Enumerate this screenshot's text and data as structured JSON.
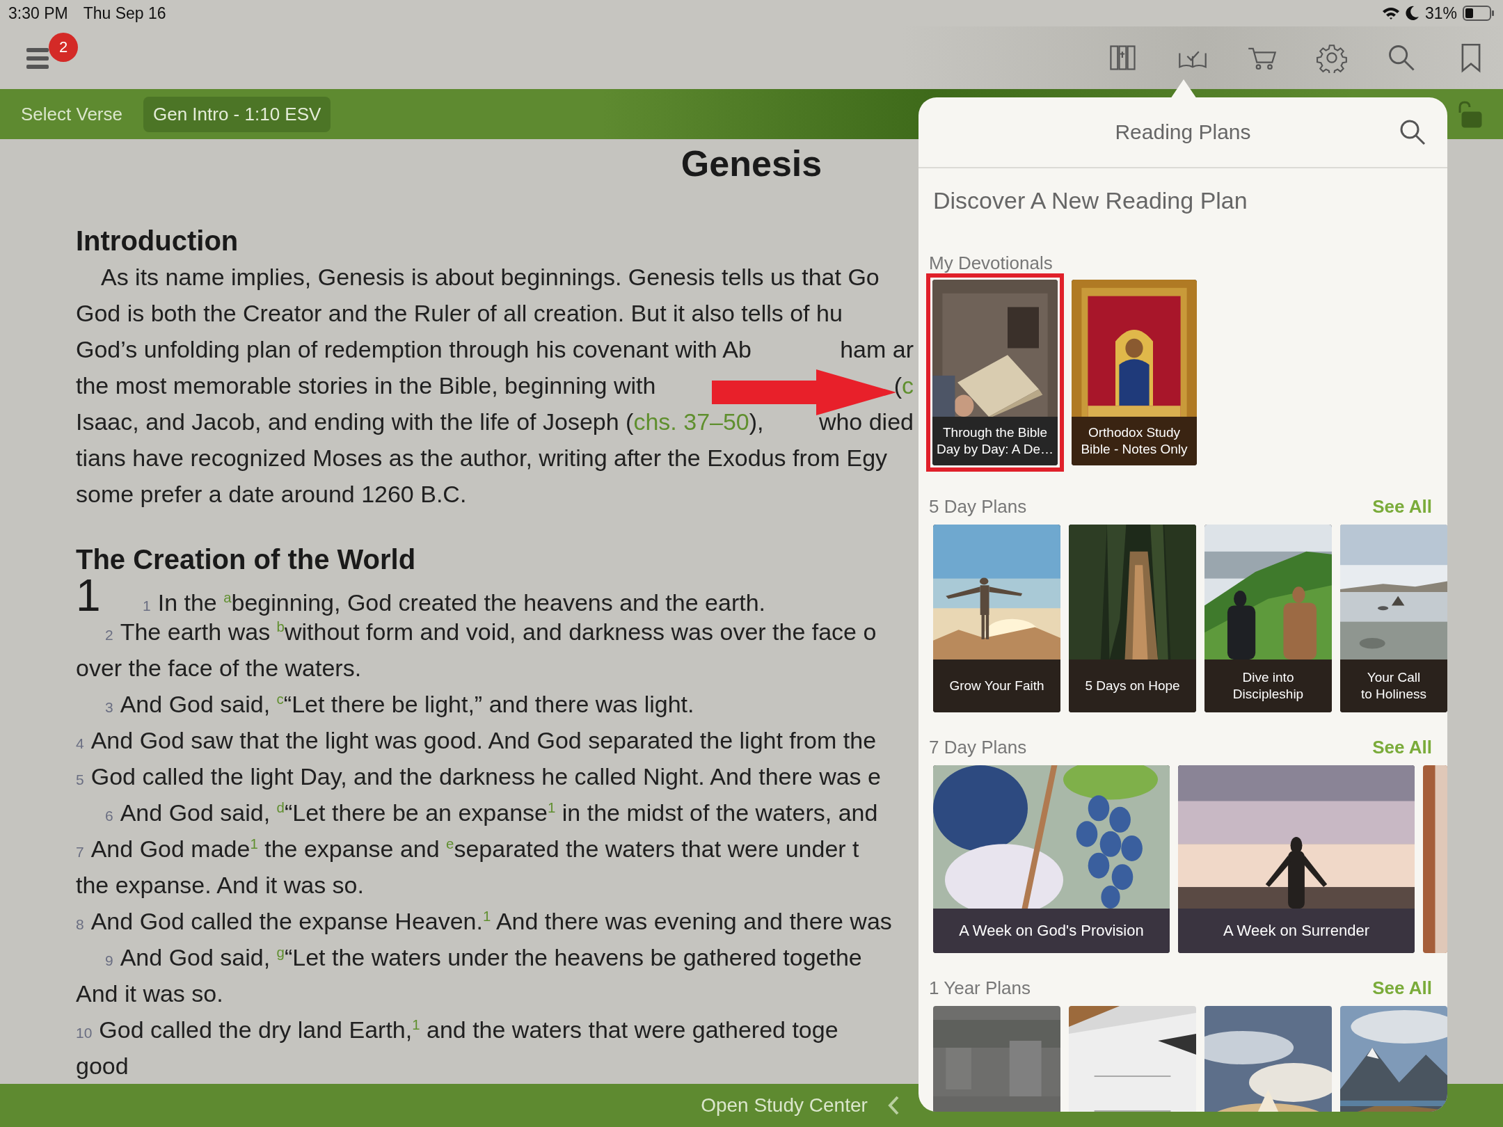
{
  "status_bar": {
    "time": "3:30 PM",
    "date": "Thu Sep 16",
    "battery": "31%"
  },
  "toolbar": {
    "menu_badge": "2"
  },
  "verse_bar": {
    "label": "Select Verse",
    "reference": "Gen Intro - 1:10 ESV"
  },
  "book_title": "Genesis",
  "sections": [
    {
      "heading": "Introduction",
      "lines": [
        {
          "kind": "para",
          "text": "As its name implies, Genesis is about beginnings. Genesis tells us that Go"
        },
        {
          "kind": "cont",
          "text": "God is both the Creator and the Ruler of all creation. But it also tells of hu"
        },
        {
          "kind": "cont",
          "text": "God’s unfolding plan of redemption through his covenant with Ab",
          "tail": {
            "text": "ham ar"
          }
        },
        {
          "kind": "cont",
          "text": "the most memorable stories in the Bible, beginning with",
          "tail": {
            "text": "(",
            "link": "c"
          }
        },
        {
          "kind": "cont",
          "text": "Isaac, and Jacob, and ending with the life of Joseph (",
          "link": "chs. 37–50",
          "after": "),",
          "tail": {
            "text": "who died"
          }
        },
        {
          "kind": "cont",
          "text": "tians have recognized Moses as the author, writing after the Exodus from Egy"
        },
        {
          "kind": "cont",
          "text": "some prefer a date around 1260 B.C."
        }
      ]
    },
    {
      "heading": "The Creation of the World",
      "chapter": "1",
      "lines": [
        {
          "kind": "chapter",
          "verse": "1",
          "text": "In the $^{a}$beginning, God created the heavens and the earth."
        },
        {
          "kind": "indent",
          "verse": "2",
          "text": "The earth was $^{b}$without form and void, and darkness was over the face o"
        },
        {
          "kind": "cont",
          "text": "over the face of the waters."
        },
        {
          "kind": "indent",
          "verse": "3",
          "text": "And God said, $^{c}$“Let there be light,” and there was light."
        },
        {
          "kind": "flush",
          "verse": "4",
          "text": "And God saw that the light was good. And God separated the light from the"
        },
        {
          "kind": "flush",
          "verse": "5",
          "text": "God called the light Day, and the darkness he called Night. And there was e"
        },
        {
          "kind": "indent",
          "verse": "6",
          "text": "And God said, $^{d}$“Let there be an expanse$^{1}$ in the midst of the waters, and"
        },
        {
          "kind": "flush",
          "verse": "7",
          "text": "And God made$^{1}$ the expanse and $^{e}$separated the waters that were under t"
        },
        {
          "kind": "cont",
          "text": "the expanse. And it was so."
        },
        {
          "kind": "flush",
          "verse": "8",
          "text": "And God called the expanse Heaven.$^{1}$ And there was evening and there was"
        },
        {
          "kind": "indent",
          "verse": "9",
          "text": "And God said, $^{g}$“Let the waters under the heavens be gathered togethe"
        },
        {
          "kind": "cont",
          "text": "And it was so."
        },
        {
          "kind": "flush",
          "verse": "10",
          "text": "God called the dry land Earth,$^{1}$ and the waters that were gathered toge"
        },
        {
          "kind": "cont",
          "text": "good"
        }
      ]
    }
  ],
  "bottom_bar": {
    "label": "Open Study Center"
  },
  "popover": {
    "title": "Reading Plans",
    "subtitle": "Discover A New Reading Plan",
    "groups": [
      {
        "kind": "devotional",
        "title": "My Devotionals",
        "items": [
          {
            "title": "Through the Bible\nDay by Day: A De…",
            "highlighted": true
          },
          {
            "title": "Orthodox Study\nBible - Notes  Only",
            "highlighted": false
          }
        ]
      },
      {
        "kind": "tall",
        "title": "5 Day Plans",
        "see_all": "See All",
        "items": [
          {
            "title": "Grow Your Faith"
          },
          {
            "title": "5 Days on Hope"
          },
          {
            "title": "Dive into\nDiscipleship"
          },
          {
            "title": "Your Call\nto Holiness"
          }
        ]
      },
      {
        "kind": "wide",
        "title": "7 Day Plans",
        "see_all": "See All",
        "items": [
          {
            "title": "A Week on God's Provision"
          },
          {
            "title": "A Week on Surrender"
          },
          {
            "kind": "picture"
          }
        ]
      },
      {
        "kind": "short",
        "title": "1 Year Plans",
        "see_all": "See All",
        "items": [
          {
            "kind": "picture"
          },
          {
            "kind": "picture"
          },
          {
            "kind": "picture"
          },
          {
            "kind": "picture"
          }
        ]
      }
    ]
  }
}
